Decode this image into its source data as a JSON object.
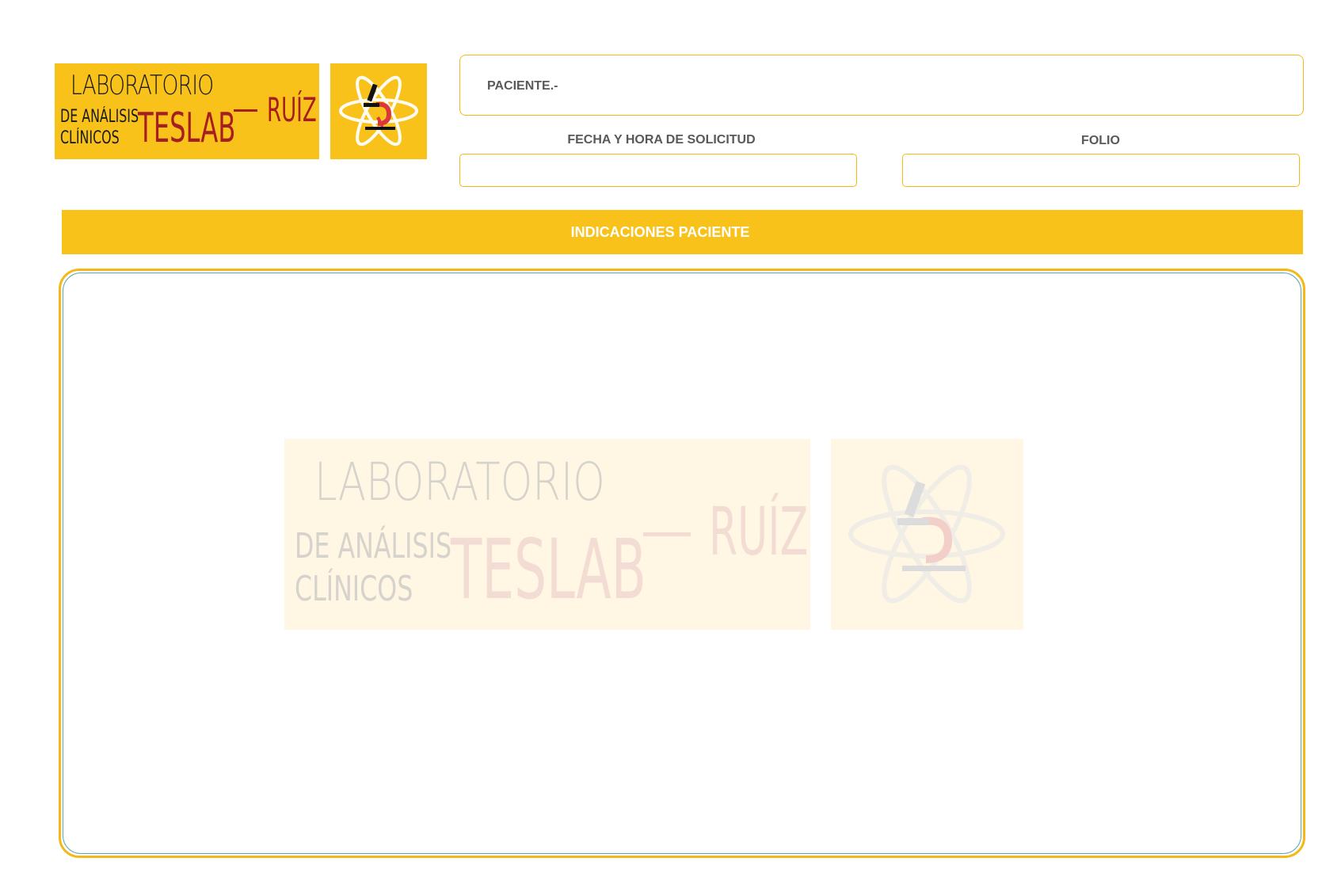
{
  "header": {
    "logo": {
      "line1": "LABORATORIO",
      "line2": "DE ANÁLISIS",
      "line3": "CLÍNICOS",
      "brand": "TESLAB",
      "suffix": "RUÍZ"
    }
  },
  "form": {
    "patient_label": "PACIENTE.-",
    "patient_value": "",
    "request_datetime_label": "FECHA Y HORA DE SOLICITUD",
    "request_datetime_value": "",
    "folio_label": "FOLIO",
    "folio_value": ""
  },
  "banner": {
    "title": "INDICACIONES PACIENTE"
  },
  "indications": {
    "content": "",
    "watermark": {
      "line1": "LABORATORIO",
      "line2": "DE ANÁLISIS",
      "line3": "CLÍNICOS",
      "brand": "TESLAB",
      "suffix": "RUÍZ"
    }
  },
  "colors": {
    "accent": "#F8C21A",
    "brand_red": "#A51F22",
    "border_yellow": "#F4B818",
    "inner_border_teal": "#5FA7AE",
    "label_gray": "#595959"
  }
}
